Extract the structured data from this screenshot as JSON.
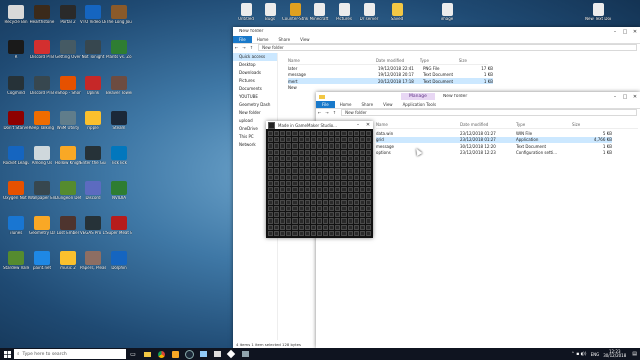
{
  "desktop": {
    "left_icons": [
      {
        "label": "Recycle Bin",
        "color": "#d9d9d9"
      },
      {
        "label": "Hearthstone",
        "color": "#3b2a1a"
      },
      {
        "label": "Portal 2",
        "color": "#2a2a2a"
      },
      {
        "label": "VTO Video Downloader",
        "color": "#1565c0"
      },
      {
        "label": "The Long Journey...",
        "color": "#8a5a2a"
      },
      {
        "label": "R",
        "color": "#1a1a1a"
      },
      {
        "label": "Discord PTB",
        "color": "#d32f2f"
      },
      {
        "label": "Getting Over It",
        "color": "#455a64"
      },
      {
        "label": "Not Tonight",
        "color": "#37474f"
      },
      {
        "label": "Plants vs. Zombies",
        "color": "#2e7d32"
      },
      {
        "label": "Cogmind",
        "color": "#263238"
      },
      {
        "label": "Discord PTB",
        "color": "#37474f"
      },
      {
        "label": "eShop - Shortcut",
        "color": "#e65100"
      },
      {
        "label": "Uplink",
        "color": "#c62828"
      },
      {
        "label": "Beaver Tower",
        "color": "#6d4c41"
      },
      {
        "label": "Don't Starve",
        "color": "#8e0000"
      },
      {
        "label": "Keep Talking and Nobody Explodes",
        "color": "#ef6c00"
      },
      {
        "label": "WiiM Utility",
        "color": "#607d8b"
      },
      {
        "label": "ripple",
        "color": "#fbc02d"
      },
      {
        "label": "Steam",
        "color": "#1b2838"
      },
      {
        "label": "Rocket League",
        "color": "#1565c0"
      },
      {
        "label": "Among Us",
        "color": "#cfd8dc"
      },
      {
        "label": "Hollow Knight",
        "color": "#f9a825"
      },
      {
        "label": "Enter the Gungeon",
        "color": "#263238"
      },
      {
        "label": "TickTick",
        "color": "#0277bd"
      },
      {
        "label": "Oxygen Not Included",
        "color": "#e65100"
      },
      {
        "label": "Wallpaper Engine",
        "color": "#37474f"
      },
      {
        "label": "Dungeon Defenders",
        "color": "#558b2f"
      },
      {
        "label": "Discord",
        "color": "#5c6bc0"
      },
      {
        "label": "NVIDIA",
        "color": "#2e7d32"
      },
      {
        "label": "iTunes",
        "color": "#1976d2"
      },
      {
        "label": "Geometry Dash",
        "color": "#f9a825"
      },
      {
        "label": "Lost Ember",
        "color": "#4e342e"
      },
      {
        "label": "VEGAS Pro 15.0",
        "color": "#263238"
      },
      {
        "label": "Super Meat Boy",
        "color": "#b71c1c"
      },
      {
        "label": "Stardew Valley",
        "color": "#558b2f"
      },
      {
        "label": "paint.net",
        "color": "#1e88e5"
      },
      {
        "label": "music 2",
        "color": "#fbc02d"
      },
      {
        "label": "Papers, Please",
        "color": "#8d6e63"
      },
      {
        "label": "Dolphin",
        "color": "#1565c0"
      }
    ],
    "top_icons": [
      {
        "label": "Untitled",
        "color": "#ececec"
      },
      {
        "label": "Bugs",
        "color": "#ececec"
      },
      {
        "label": "Counter-Strike",
        "color": "#e0a020"
      },
      {
        "label": "Minecraft",
        "color": "#ececec"
      },
      {
        "label": "Pictures",
        "color": "#ececec"
      },
      {
        "label": "Dr server",
        "color": "#ececec"
      },
      {
        "label": "Saved",
        "color": "#f2c744"
      },
      {
        "label": "image",
        "color": "#ececec"
      },
      {
        "label": "New Text Document",
        "color": "#ececec"
      }
    ]
  },
  "explorer_back": {
    "title": "New folder",
    "ribbon": [
      "File",
      "Home",
      "Share",
      "View"
    ],
    "address": "New folder",
    "nav": [
      "Quick access",
      "Desktop",
      "Downloads",
      "Pictures",
      "Documents",
      "YOUTUBE",
      "Geometry Dash",
      "New folder",
      "upload",
      "OneDrive",
      "This PC",
      "Network"
    ],
    "columns": [
      "Name",
      "Date modified",
      "Type",
      "Size"
    ],
    "rows": [
      {
        "name": "later",
        "date": "19/12/2018 22:41",
        "type": "PNG File",
        "size": "17 KB"
      },
      {
        "name": "message",
        "date": "19/12/2018 20:17",
        "type": "Text Document",
        "size": "1 KB"
      },
      {
        "name": "mert",
        "date": "20/12/2018 17:18",
        "type": "Text Document",
        "size": "1 KB"
      },
      {
        "name": "New",
        "date": "",
        "type": "",
        "size": ""
      }
    ],
    "status": "4 items   1 item selected 128 bytes"
  },
  "explorer_front": {
    "title": "New folder",
    "manage_tab": "Manage",
    "ribbon": [
      "File",
      "Home",
      "Share",
      "View",
      "Application Tools"
    ],
    "address": "New folder",
    "columns": [
      "Name",
      "Date modified",
      "Type",
      "Size"
    ],
    "rows": [
      {
        "name": "data.win",
        "date": "23/12/2018 01:27",
        "type": "WIN File",
        "size": "5 KB"
      },
      {
        "name": "grid",
        "date": "23/12/2018 01:27",
        "type": "Application",
        "size": "4,766 KB"
      },
      {
        "name": "message",
        "date": "30/12/2018 12:20",
        "type": "Text Document",
        "size": "1 KB"
      },
      {
        "name": "options",
        "date": "23/12/2018 12:23",
        "type": "Configuration setti...",
        "size": "1 KB"
      }
    ]
  },
  "game_window": {
    "title": "Made in GameMaker Studio...",
    "grid_cols": 17,
    "grid_rows": 17
  },
  "taskbar": {
    "search_placeholder": "Type here to search",
    "time": "12:23",
    "date": "30/12/2018",
    "lang": "ENG"
  }
}
